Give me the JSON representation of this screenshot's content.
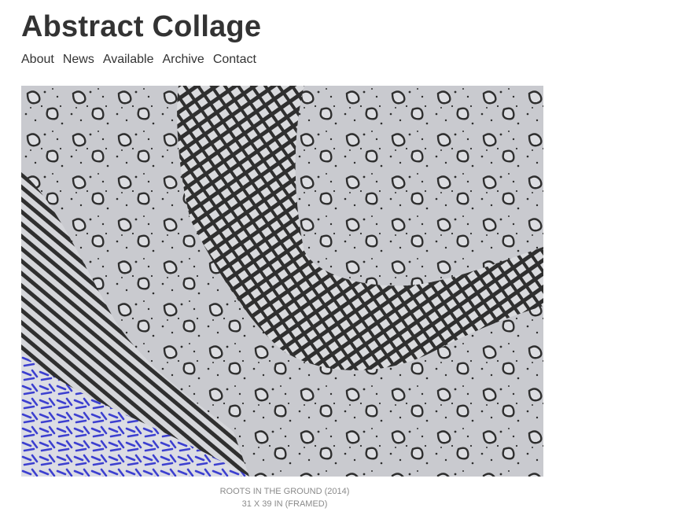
{
  "site": {
    "title": "Abstract Collage"
  },
  "nav": {
    "items": [
      "About",
      "News",
      "Available",
      "Archive",
      "Contact"
    ]
  },
  "artwork": {
    "title_line": "ROOTS IN THE GROUND (2014)",
    "size_line": "31 X 39 IN (FRAMED)"
  },
  "colors": {
    "text": "#333333",
    "caption": "#8a8a8a",
    "paper": "#c7c8cc",
    "ink": "#2e2e2e",
    "blue": "#3c3fd0"
  }
}
